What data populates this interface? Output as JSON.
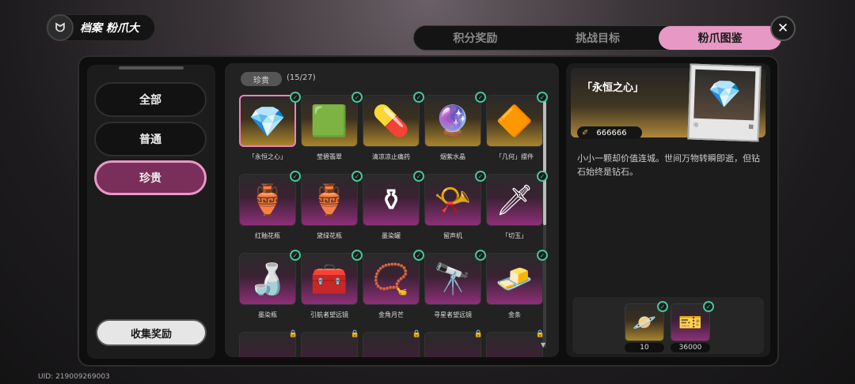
{
  "header": {
    "logo_text": "ᗢ",
    "title": "档案 粉爪大"
  },
  "tabs": [
    {
      "label": "积分奖励"
    },
    {
      "label": "挑战目标"
    },
    {
      "label": "粉爪图鉴",
      "active": true
    }
  ],
  "close_icon": "✕",
  "sidebar": {
    "categories": [
      {
        "label": "全部"
      },
      {
        "label": "普通"
      },
      {
        "label": "珍贵",
        "active": true
      }
    ],
    "collect_label": "收集奖励"
  },
  "grid": {
    "filter_label": "珍贵",
    "count": "(15/27)",
    "items": [
      {
        "name": "「永恒之心」",
        "icon": "💎",
        "frame": "gold",
        "collected": true,
        "selected": true
      },
      {
        "name": "莹碧翡翠",
        "icon": "🟩",
        "frame": "gold",
        "collected": true
      },
      {
        "name": "清凉凉止痛药",
        "icon": "💊",
        "frame": "gold",
        "collected": true
      },
      {
        "name": "烟紫水晶",
        "icon": "🔮",
        "frame": "gold",
        "collected": true
      },
      {
        "name": "「几何」摆件",
        "icon": "🔶",
        "frame": "gold",
        "collected": true
      },
      {
        "name": "红釉花瓶",
        "icon": "🏺",
        "frame": "purple",
        "collected": true
      },
      {
        "name": "黛绿花瓶",
        "icon": "🏺",
        "frame": "purple",
        "collected": true
      },
      {
        "name": "墨染罐",
        "icon": "⚱",
        "frame": "purple",
        "collected": true
      },
      {
        "name": "留声机",
        "icon": "📯",
        "frame": "purple",
        "collected": true
      },
      {
        "name": "「切玉」",
        "icon": "🗡",
        "frame": "purple",
        "collected": true
      },
      {
        "name": "墨染瓶",
        "icon": "🍶",
        "frame": "purple",
        "collected": true
      },
      {
        "name": "引航者望远镜",
        "icon": "🧰",
        "frame": "purple",
        "collected": true
      },
      {
        "name": "金角月芒",
        "icon": "📿",
        "frame": "purple",
        "collected": true
      },
      {
        "name": "寻星者望远镜",
        "icon": "🔭",
        "frame": "purple",
        "collected": true
      },
      {
        "name": "金条",
        "icon": "🧈",
        "frame": "purple",
        "collected": true
      },
      {
        "name": "",
        "icon": "",
        "frame": "purple",
        "collected": false
      },
      {
        "name": "",
        "icon": "",
        "frame": "purple",
        "collected": false
      },
      {
        "name": "",
        "icon": "",
        "frame": "purple",
        "collected": false
      },
      {
        "name": "",
        "icon": "",
        "frame": "purple",
        "collected": false
      },
      {
        "name": "",
        "icon": "",
        "frame": "purple",
        "collected": false
      }
    ]
  },
  "detail": {
    "title": "「永恒之心」",
    "value_icon": "✐",
    "value": "666666",
    "photo_icon": "💎",
    "description": "小小一颗却价值连城。世间万物转瞬即逝，但钻石始终是钻石。",
    "rewards": [
      {
        "icon": "🪐",
        "frame": "gold",
        "qty": "10"
      },
      {
        "icon": "🎫",
        "frame": "purple",
        "qty": "36000"
      }
    ]
  },
  "uid": "UID: 219009269003",
  "colors": {
    "accent": "#e898c4",
    "check": "#46c49a",
    "gold": "#a8842c",
    "purple": "#8e2f78"
  }
}
